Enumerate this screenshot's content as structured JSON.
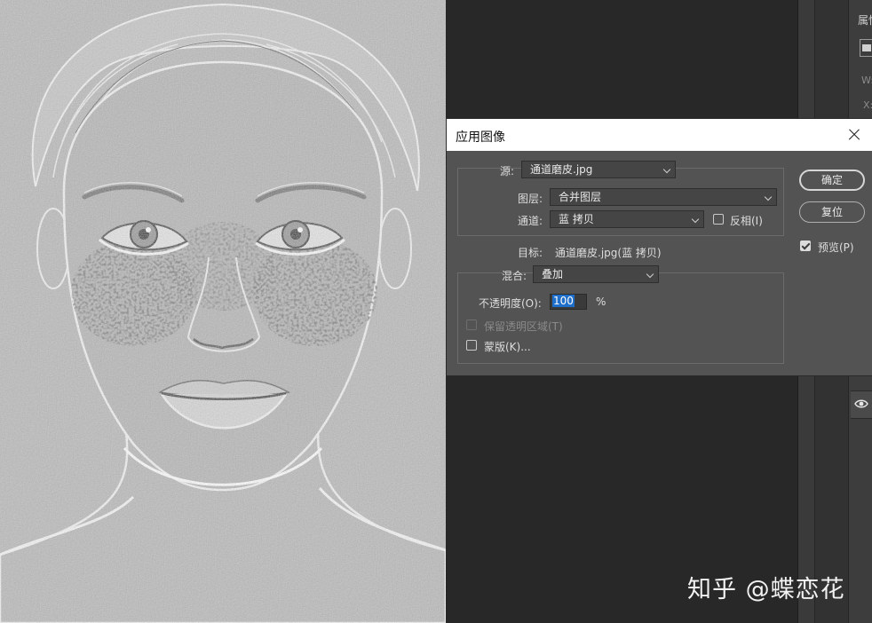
{
  "dialog": {
    "title": "应用图像",
    "source_label": "源:",
    "source_value": "通道磨皮.jpg",
    "layer_label": "图层:",
    "layer_value": "合并图层",
    "channel_label": "通道:",
    "channel_value": "蓝 拷贝",
    "invert_label": "反相(I)",
    "invert_checked": false,
    "target_label": "目标:",
    "target_value": "通道磨皮.jpg(蓝 拷贝)",
    "blend_label": "混合:",
    "blend_value": "叠加",
    "opacity_label": "不透明度(O):",
    "opacity_value": "100",
    "opacity_unit": "%",
    "preserve_transparency_label": "保留透明区域(T)",
    "mask_label": "蒙版(K)...",
    "ok_label": "确定",
    "reset_label": "复位",
    "preview_label": "预览(P)",
    "preview_checked": true
  },
  "panel": {
    "title_partial": "属性",
    "w_label": "W:",
    "x_label": "X:"
  },
  "watermark": "知乎 @蝶恋花",
  "colors": {
    "dialog_bg": "#535353",
    "workspace_bg": "#282828",
    "selection": "#1f6ec9"
  }
}
